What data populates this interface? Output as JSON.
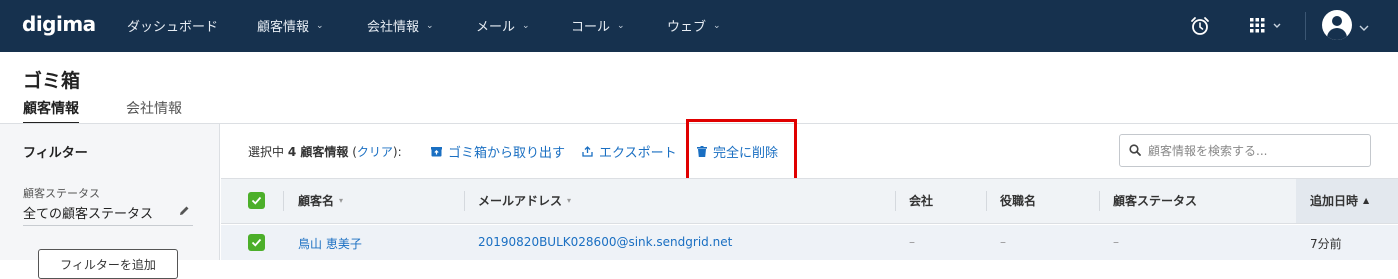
{
  "app": {
    "logo": "digima",
    "nav": [
      {
        "label": "ダッシュボード",
        "dropdown": false
      },
      {
        "label": "顧客情報",
        "dropdown": true
      },
      {
        "label": "会社情報",
        "dropdown": true
      },
      {
        "label": "メール",
        "dropdown": true
      },
      {
        "label": "コール",
        "dropdown": true
      },
      {
        "label": "ウェブ",
        "dropdown": true
      }
    ],
    "right_icons": [
      "alarm-clock-icon",
      "apps-grid-icon",
      "user-avatar-icon"
    ]
  },
  "page": {
    "title": "ゴミ箱",
    "tabs": [
      {
        "label": "顧客情報",
        "active": true
      },
      {
        "label": "会社情報",
        "active": false
      }
    ]
  },
  "sidebar": {
    "title": "フィルター",
    "status_label": "顧客ステータス",
    "status_value": "全ての顧客ステータス",
    "filter_button": "フィルターを追加"
  },
  "actionbar": {
    "selected_prefix": "選択中",
    "selected_count": "4 顧客情報",
    "clear_open": "(",
    "clear_link": "クリア",
    "clear_close": "):",
    "restore": "ゴミ箱から取り出す",
    "export": "エクスポート",
    "delete": "完全に削除",
    "search_placeholder": "顧客情報を検索する..."
  },
  "table": {
    "columns": [
      "顧客名",
      "メールアドレス",
      "会社",
      "役職名",
      "顧客ステータス",
      "追加日時"
    ],
    "sorted_column": "追加日時",
    "sort_direction": "asc",
    "rows": [
      {
        "checked": true,
        "name": "鳥山 恵美子",
        "email": "20190820BULK028600@sink.sendgrid.net",
        "company": "–",
        "title": "–",
        "status": "–",
        "added": "7分前"
      }
    ]
  },
  "colors": {
    "nav_bg": "#16314e",
    "link": "#1a6fc2",
    "checkbox": "#4caf2a",
    "highlight_box": "#e00000"
  }
}
